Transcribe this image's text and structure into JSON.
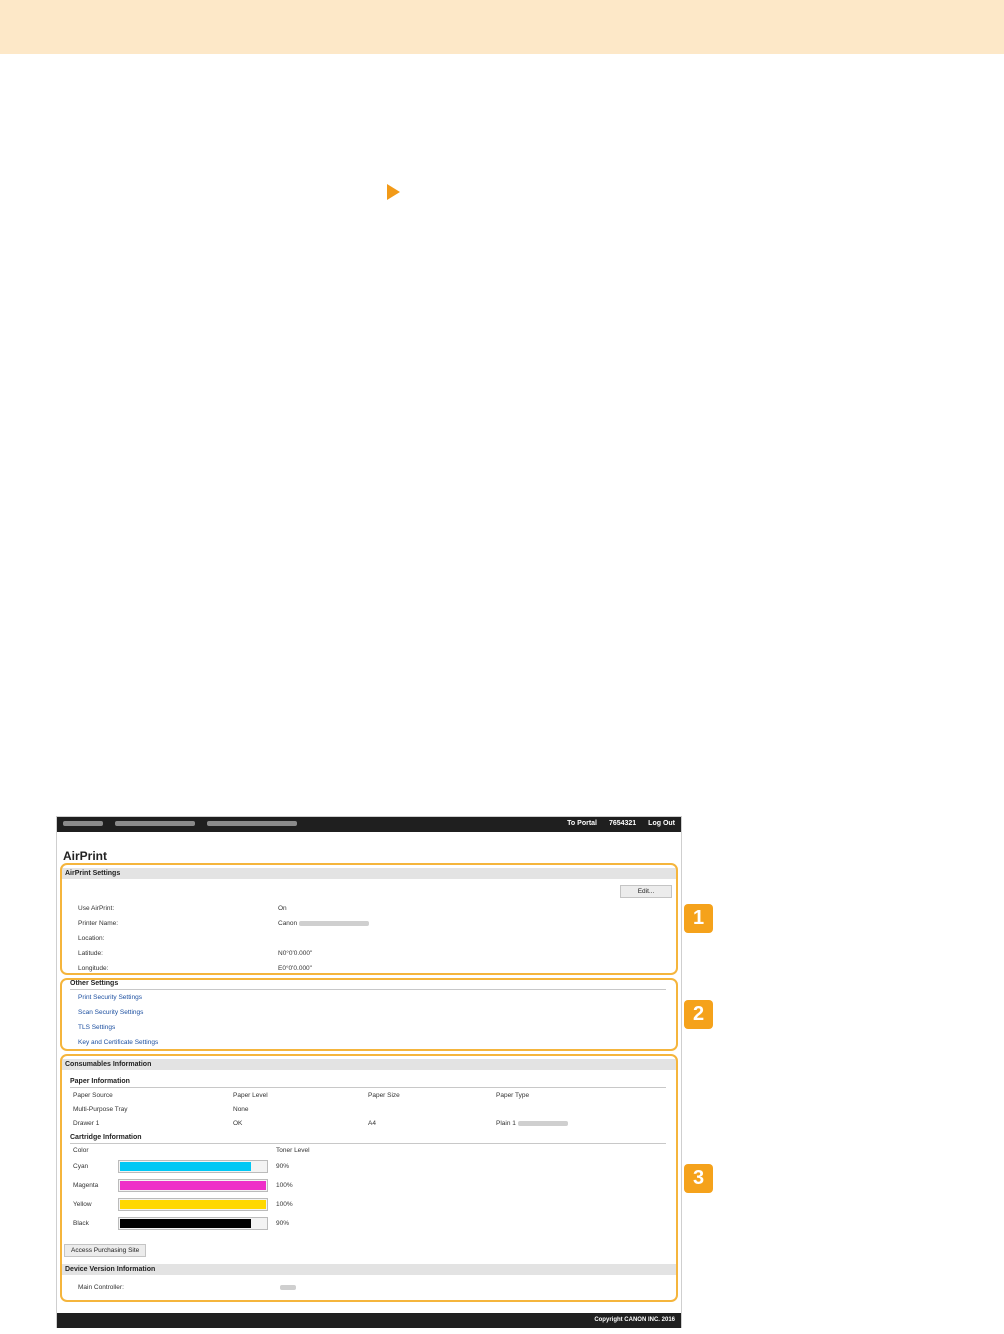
{
  "topbar": {
    "to_portal": "To Portal",
    "user_id": "7654321",
    "log_out": "Log Out"
  },
  "page_title": "AirPrint",
  "airprint_settings": {
    "heading": "AirPrint Settings",
    "edit_button": "Edit...",
    "rows": [
      {
        "label": "Use AirPrint:",
        "value": "On"
      },
      {
        "label": "Printer Name:",
        "value": "Canon"
      },
      {
        "label": "Location:",
        "value": ""
      },
      {
        "label": "Latitude:",
        "value": "N0°0'0.000\""
      },
      {
        "label": "Longitude:",
        "value": "E0°0'0.000\""
      }
    ]
  },
  "other_settings": {
    "heading": "Other Settings",
    "links": [
      "Print Security Settings",
      "Scan Security Settings",
      "TLS Settings",
      "Key and Certificate Settings"
    ]
  },
  "consumables": {
    "heading": "Consumables Information",
    "paper": {
      "heading": "Paper Information",
      "columns": [
        "Paper Source",
        "Paper Level",
        "Paper Size",
        "Paper Type"
      ],
      "rows": [
        [
          "Multi-Purpose Tray",
          "None",
          "",
          ""
        ],
        [
          "Drawer 1",
          "OK",
          "A4",
          "Plain 1"
        ]
      ]
    },
    "cartridge": {
      "heading": "Cartridge Information",
      "columns": [
        "Color",
        "Toner Level"
      ],
      "rows": [
        {
          "name": "Cyan",
          "level_text": "90%",
          "level": 0.9,
          "color": "#00c8f5"
        },
        {
          "name": "Magenta",
          "level_text": "100%",
          "level": 1.0,
          "color": "#ee2fc8"
        },
        {
          "name": "Yellow",
          "level_text": "100%",
          "level": 1.0,
          "color": "#ffd800"
        },
        {
          "name": "Black",
          "level_text": "90%",
          "level": 0.9,
          "color": "#000000"
        }
      ]
    },
    "purchase_button": "Access Purchasing Site"
  },
  "device_version": {
    "heading": "Device Version Information",
    "main_controller_label": "Main Controller:"
  },
  "footer": {
    "copyright": "Copyright CANON INC. 2016"
  },
  "badges": [
    "1",
    "2",
    "3"
  ],
  "colors": {
    "accent": "#f5a21b",
    "highlight": "#f5b53c",
    "band": "#fde8c8",
    "link": "#1c4fa0"
  }
}
